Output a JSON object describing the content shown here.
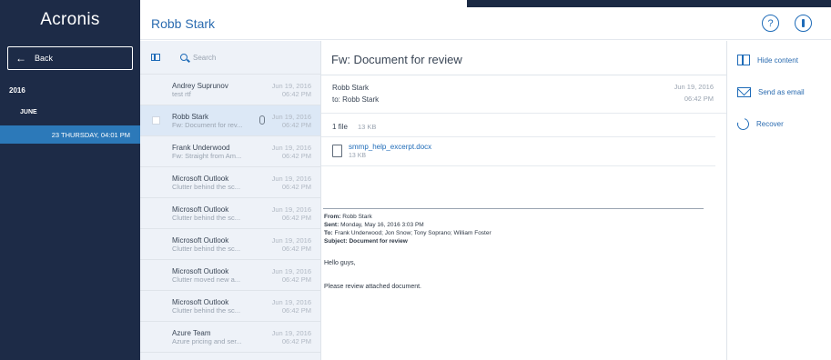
{
  "sidebar": {
    "logo": "Acronis",
    "back_label": "Back",
    "year": "2016",
    "month": "JUNE",
    "day": "23 THURSDAY, 04:01 PM"
  },
  "header": {
    "user": "Robb Stark",
    "help_symbol": "?"
  },
  "list": {
    "search_placeholder": "Search",
    "items": [
      {
        "sender": "Andrey Suprunov",
        "preview": "test rtf",
        "date": "Jun 19, 2016",
        "time": "06:42 PM"
      },
      {
        "sender": "Robb Stark",
        "preview": "Fw: Document for rev...",
        "date": "Jun 19, 2016",
        "time": "06:42 PM"
      },
      {
        "sender": "Frank Underwood",
        "preview": "Fw: Straight from Am...",
        "date": "Jun 19, 2016",
        "time": "06:42 PM"
      },
      {
        "sender": "Microsoft Outlook",
        "preview": "Clutter behind the sc...",
        "date": "Jun 19, 2016",
        "time": "06:42 PM"
      },
      {
        "sender": "Microsoft Outlook",
        "preview": "Clutter behind the sc...",
        "date": "Jun 19, 2016",
        "time": "06:42 PM"
      },
      {
        "sender": "Microsoft Outlook",
        "preview": "Clutter behind the sc...",
        "date": "Jun 19, 2016",
        "time": "06:42 PM"
      },
      {
        "sender": "Microsoft Outlook",
        "preview": "Clutter moved new a...",
        "date": "Jun 19, 2016",
        "time": "06:42 PM"
      },
      {
        "sender": "Microsoft Outlook",
        "preview": "Clutter behind the sc...",
        "date": "Jun 19, 2016",
        "time": "06:42 PM"
      },
      {
        "sender": "Azure Team",
        "preview": "Azure pricing and ser...",
        "date": "Jun 19, 2016",
        "time": "06:42 PM"
      }
    ]
  },
  "message": {
    "subject": "Fw: Document for review",
    "from": "Robb Stark",
    "to": "to: Robb Stark",
    "date": "Jun 19, 2016",
    "time": "06:42 PM",
    "files_count": "1 file",
    "files_size": "13 KB",
    "attachment_name": "smmp_help_excerpt.docx",
    "attachment_size": "13 KB",
    "quote": {
      "from_label": "From:",
      "from_value": "Robb Stark",
      "sent_label": "Sent:",
      "sent_value": "Monday, May 16, 2016 3:03 PM",
      "to_label": "To:",
      "to_value": "Frank Underwood; Jon Snow; Tony Soprano; William Foster",
      "subject_label": "Subject:",
      "subject_value": "Document for review"
    },
    "body_greeting": "Hello guys,",
    "body_text": "Please review attached document."
  },
  "actions": {
    "hide": "Hide content",
    "send": "Send as email",
    "recover": "Recover"
  }
}
